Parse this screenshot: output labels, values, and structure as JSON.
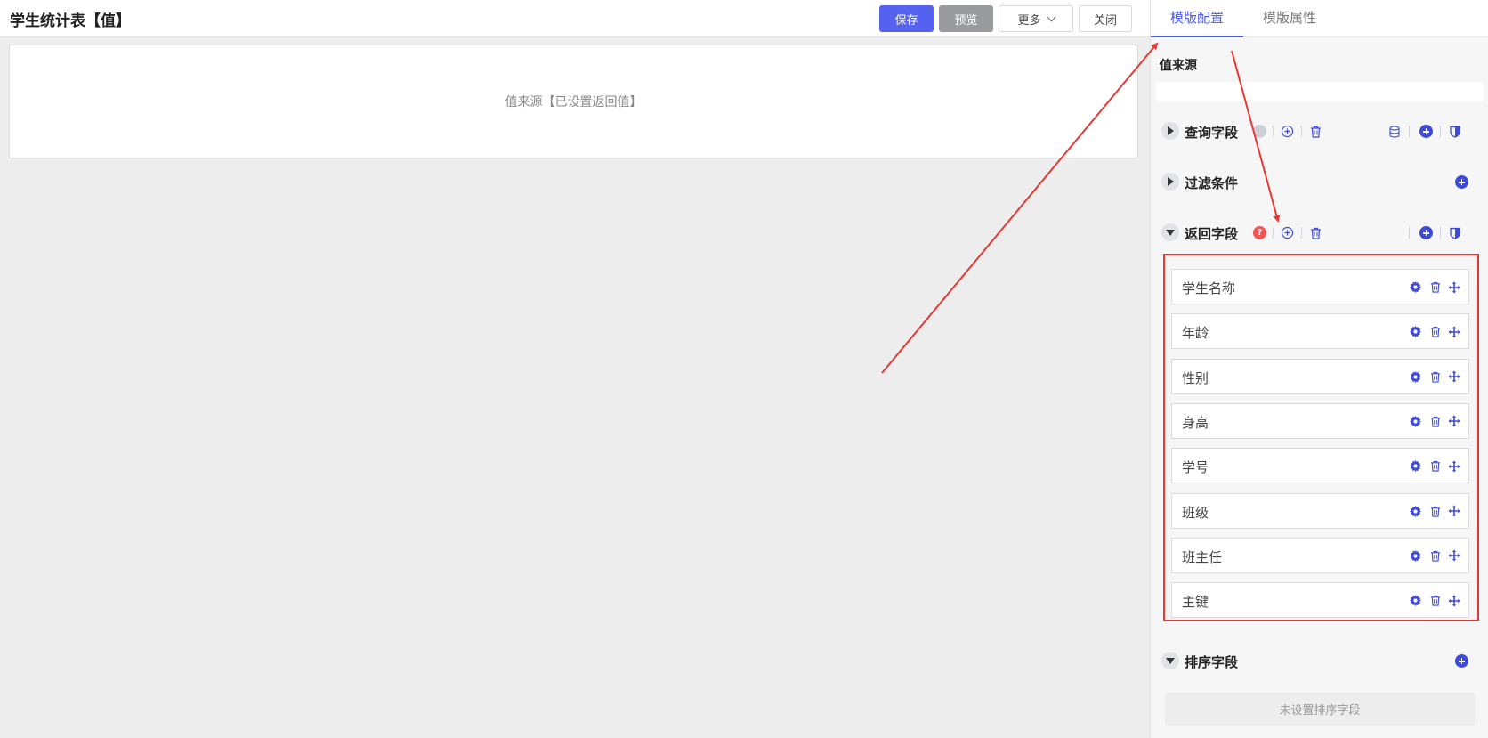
{
  "header": {
    "title": "学生统计表【值】",
    "save_label": "保存",
    "preview_label": "预览",
    "more_label": "更多",
    "close_label": "关闭"
  },
  "canvas": {
    "placeholder": "值来源【已设置返回值】"
  },
  "panel": {
    "tabs": [
      {
        "label": "模版配置",
        "active": true
      },
      {
        "label": "模版属性",
        "active": false
      }
    ],
    "source_label": "值来源",
    "groups": {
      "query": {
        "title": "查询字段"
      },
      "filter": {
        "title": "过滤条件"
      },
      "return": {
        "title": "返回字段",
        "help_glyph": "?"
      },
      "sort": {
        "title": "排序字段",
        "empty_text": "未设置排序字段"
      }
    },
    "return_fields": [
      "学生名称",
      "年龄",
      "性别",
      "身高",
      "学号",
      "班级",
      "班主任",
      "主键"
    ]
  },
  "colors": {
    "accent": "#4a58e8",
    "highlight_box": "#e53935",
    "annotation_arrow": "#e53935"
  }
}
